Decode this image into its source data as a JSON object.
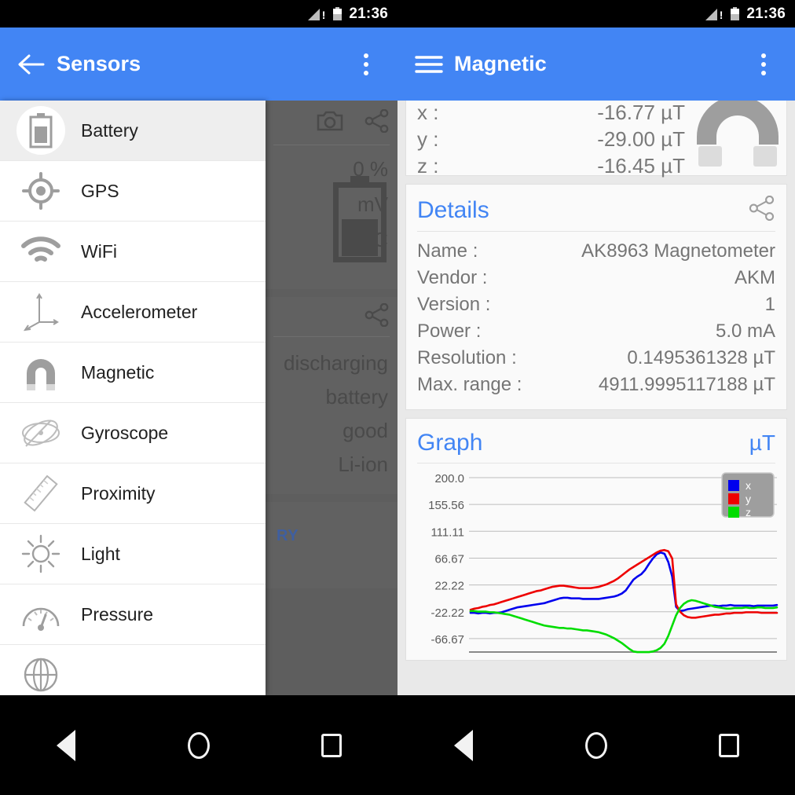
{
  "status_bar": {
    "time": "21:36",
    "signal_icon": "signal-warning-icon",
    "battery_icon": "battery-icon"
  },
  "left_window": {
    "app_bar": {
      "title": "Sensors",
      "back_icon": "back-arrow-icon",
      "overflow_icon": "overflow-menu-icon"
    },
    "drawer": {
      "items": [
        {
          "label": "Battery",
          "icon": "battery-icon",
          "active": true
        },
        {
          "label": "GPS",
          "icon": "gps-crosshair-icon",
          "active": false
        },
        {
          "label": "WiFi",
          "icon": "wifi-icon",
          "active": false
        },
        {
          "label": "Accelerometer",
          "icon": "axes-icon",
          "active": false
        },
        {
          "label": "Magnetic",
          "icon": "magnet-icon",
          "active": false
        },
        {
          "label": "Gyroscope",
          "icon": "gyroscope-icon",
          "active": false
        },
        {
          "label": "Proximity",
          "icon": "ruler-icon",
          "active": false
        },
        {
          "label": "Light",
          "icon": "sun-icon",
          "active": false
        },
        {
          "label": "Pressure",
          "icon": "gauge-icon",
          "active": false
        },
        {
          "label": "",
          "icon": "globe-icon",
          "active": false
        }
      ]
    },
    "background_page": {
      "camera_icon": "camera-icon",
      "share_icon": "share-icon",
      "values": [
        "0 %",
        "mV",
        "8 °C"
      ],
      "status_values": [
        "discharging",
        "battery",
        "good",
        "Li-ion"
      ],
      "link": "RY"
    }
  },
  "right_window": {
    "app_bar": {
      "title": "Magnetic",
      "menu_icon": "hamburger-icon",
      "overflow_icon": "overflow-menu-icon"
    },
    "readings": {
      "magnet_icon": "magnet-icon",
      "rows": [
        {
          "key": "x :",
          "value": "-16.77 µT"
        },
        {
          "key": "y :",
          "value": "-29.00 µT"
        },
        {
          "key": "z :",
          "value": "-16.45 µT"
        }
      ]
    },
    "details": {
      "title": "Details",
      "share_icon": "share-icon",
      "rows": [
        {
          "key": "Name :",
          "value": "AK8963 Magnetometer"
        },
        {
          "key": "Vendor :",
          "value": "AKM"
        },
        {
          "key": "Version :",
          "value": "1"
        },
        {
          "key": "Power :",
          "value": "5.0 mA"
        },
        {
          "key": "Resolution :",
          "value": "0.1495361328 µT"
        },
        {
          "key": "Max. range :",
          "value": "4911.9995117188 µT"
        }
      ]
    },
    "graph": {
      "title": "Graph",
      "unit": "µT"
    }
  },
  "nav_bar": {
    "back_icon": "nav-back-icon",
    "home_icon": "nav-home-icon",
    "recents_icon": "nav-recents-icon"
  },
  "colors": {
    "accent_blue": "#4285f4",
    "series_x": "#0000ee",
    "series_y": "#ee0000",
    "series_z": "#00dd00",
    "status_bar": "#000000",
    "panel_bg": "#e9e9e9"
  },
  "chart_data": {
    "type": "line",
    "title": "Graph",
    "ylabel": "µT",
    "unit": "µT",
    "xlabel": "",
    "grid": true,
    "legend_position": "top-right",
    "ylim": [
      -88.89,
      200.0
    ],
    "yticks": [
      200.0,
      155.56,
      111.11,
      66.67,
      22.22,
      -22.22,
      -66.67
    ],
    "ytick_labels": [
      "200.0",
      "155.56",
      "111.11",
      "66.67",
      "22.22",
      "-22.22",
      "-66.67"
    ],
    "legend": [
      {
        "name": "x",
        "color": "#0000ee"
      },
      {
        "name": "y",
        "color": "#ee0000"
      },
      {
        "name": "z",
        "color": "#00dd00"
      }
    ],
    "x": [
      0,
      1,
      2,
      3,
      4,
      5,
      6,
      7,
      8,
      9,
      10,
      11,
      12,
      13,
      14,
      15,
      16,
      17,
      18,
      19,
      20,
      21,
      22,
      23,
      24,
      25,
      26,
      27,
      28,
      29,
      30,
      31,
      32,
      33,
      34,
      35,
      36,
      37,
      38,
      39,
      40,
      41,
      42,
      43,
      44,
      45,
      46,
      47,
      48,
      49,
      50,
      51,
      52,
      53,
      54,
      55,
      56,
      57,
      58,
      59,
      60,
      61,
      62,
      63,
      64,
      65,
      66,
      67,
      68,
      69,
      70,
      71,
      72,
      73,
      74,
      75,
      76,
      77,
      78,
      79
    ],
    "series": [
      {
        "name": "x",
        "color": "#0000ee",
        "values": [
          -24,
          -24,
          -25,
          -24,
          -24,
          -25,
          -24,
          -24,
          -23,
          -21,
          -19,
          -17,
          -15,
          -14,
          -13,
          -12,
          -11,
          -10,
          -9,
          -8,
          -6,
          -4,
          -2,
          0,
          1,
          1,
          0,
          0,
          0,
          -1,
          -1,
          -1,
          -1,
          -1,
          0,
          1,
          2,
          3,
          5,
          8,
          13,
          22,
          31,
          36,
          40,
          47,
          57,
          66,
          73,
          76,
          74,
          60,
          36,
          -14,
          -21,
          -20,
          -18,
          -17,
          -16,
          -15,
          -14,
          -13,
          -12,
          -12,
          -13,
          -12,
          -12,
          -11,
          -12,
          -12,
          -12,
          -12,
          -12,
          -13,
          -12,
          -12,
          -12,
          -12,
          -12,
          -11
        ]
      },
      {
        "name": "y",
        "color": "#ee0000",
        "values": [
          -19,
          -17,
          -16,
          -14,
          -13,
          -11,
          -10,
          -8,
          -6,
          -4,
          -2,
          0,
          2,
          4,
          6,
          8,
          10,
          12,
          13,
          15,
          17,
          19,
          20,
          21,
          21,
          20,
          19,
          18,
          17,
          17,
          17,
          17,
          18,
          19,
          21,
          23,
          26,
          29,
          33,
          38,
          43,
          48,
          52,
          56,
          60,
          64,
          68,
          72,
          76,
          79,
          80,
          78,
          66,
          -10,
          -22,
          -28,
          -31,
          -32,
          -32,
          -31,
          -30,
          -29,
          -28,
          -27,
          -27,
          -26,
          -25,
          -25,
          -24,
          -24,
          -24,
          -23,
          -23,
          -23,
          -23,
          -24,
          -24,
          -24,
          -24,
          -24
        ]
      },
      {
        "name": "z",
        "color": "#00dd00",
        "values": [
          -21,
          -21,
          -22,
          -22,
          -22,
          -23,
          -23,
          -24,
          -25,
          -26,
          -27,
          -29,
          -31,
          -33,
          -35,
          -37,
          -39,
          -41,
          -43,
          -45,
          -46,
          -47,
          -48,
          -49,
          -49,
          -50,
          -50,
          -51,
          -52,
          -53,
          -53,
          -54,
          -55,
          -56,
          -58,
          -60,
          -63,
          -66,
          -70,
          -74,
          -79,
          -84,
          -88,
          -89,
          -89,
          -89,
          -89,
          -88,
          -86,
          -82,
          -75,
          -62,
          -45,
          -28,
          -16,
          -9,
          -5,
          -3,
          -4,
          -6,
          -8,
          -10,
          -12,
          -14,
          -15,
          -16,
          -17,
          -17,
          -16,
          -16,
          -16,
          -15,
          -16,
          -16,
          -15,
          -15,
          -16,
          -16,
          -16,
          -15
        ]
      }
    ]
  }
}
